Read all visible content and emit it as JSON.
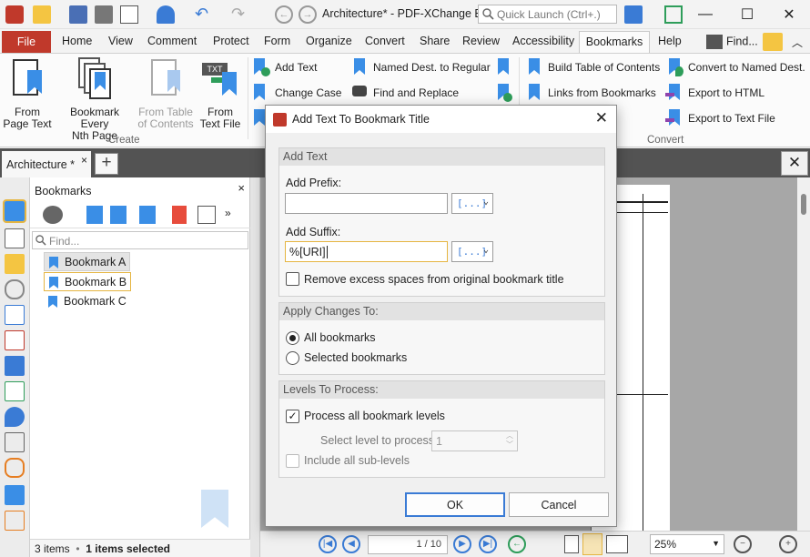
{
  "window": {
    "title": "Architecture* - PDF-XChange E...",
    "quick_launch_placeholder": "Quick Launch (Ctrl+.)",
    "minimize": "—",
    "maximize": "☐",
    "close": "✕"
  },
  "menu": {
    "file": "File",
    "items": [
      "Home",
      "View",
      "Comment",
      "Protect",
      "Form",
      "Organize",
      "Convert",
      "Share",
      "Review",
      "Accessibility"
    ],
    "active": "Bookmarks",
    "help": "Help",
    "find": "Find..."
  },
  "ribbon": {
    "big_buttons": [
      {
        "line1": "From",
        "line2": "Page Text",
        "icon": "bookmark-from-page-text-icon"
      },
      {
        "line1": "Bookmark Every",
        "line2": "Nth Page",
        "icon": "bookmark-every-nth-page-icon"
      },
      {
        "line1": "From Table",
        "line2": "of Contents",
        "icon": "bookmark-from-toc-icon"
      },
      {
        "line1": "From",
        "line2": "Text File",
        "icon": "bookmark-from-text-file-icon"
      }
    ],
    "create_group": "Create",
    "small_buttons": {
      "add_text": "Add Text",
      "change_case": "Change Case",
      "named_dest_to_regular": "Named Dest. to Regular",
      "find_and_replace": "Find and Replace",
      "build_toc": "Build Table of Contents",
      "links_from_bookmarks": "Links from Bookmarks",
      "convert_named_dest": "Convert to Named Dest.",
      "export_html": "Export to HTML",
      "export_text": "Export to Text File"
    },
    "convert_group": "Convert"
  },
  "doc_tab": {
    "name": "Architecture *",
    "close": "×",
    "add": "+",
    "panel_close": "✕"
  },
  "bookmarks_panel": {
    "title": "Bookmarks",
    "close": "×",
    "find_placeholder": "Find...",
    "items": [
      "Bookmark A",
      "Bookmark B",
      "Bookmark C"
    ],
    "status_count": "3 items",
    "status_selected": "1 items selected"
  },
  "statusbar": {
    "page": "1 / 10",
    "zoom": "25%"
  },
  "dialog": {
    "title": "Add Text To Bookmark Title",
    "close": "✕",
    "add_text_group": "Add Text",
    "prefix_label": "Add Prefix:",
    "prefix_value": "",
    "suffix_label": "Add Suffix:",
    "suffix_value": "%[URI]",
    "macro_button": "[...]",
    "remove_spaces_label": "Remove excess spaces from original bookmark title",
    "remove_spaces_checked": false,
    "apply_group": "Apply Changes To:",
    "all_bookmarks": "All bookmarks",
    "selected_bookmarks": "Selected bookmarks",
    "apply_selected": "all",
    "levels_group": "Levels To Process:",
    "process_all_label": "Process all bookmark levels",
    "process_all_checked": true,
    "select_level_label": "Select level to process:",
    "select_level_value": "1",
    "include_sublevels_label": "Include all sub-levels",
    "ok": "OK",
    "cancel": "Cancel"
  },
  "colors": {
    "accent_red": "#c0392b",
    "accent_blue": "#3a8ee6",
    "focus_yellow": "#e5b541"
  }
}
